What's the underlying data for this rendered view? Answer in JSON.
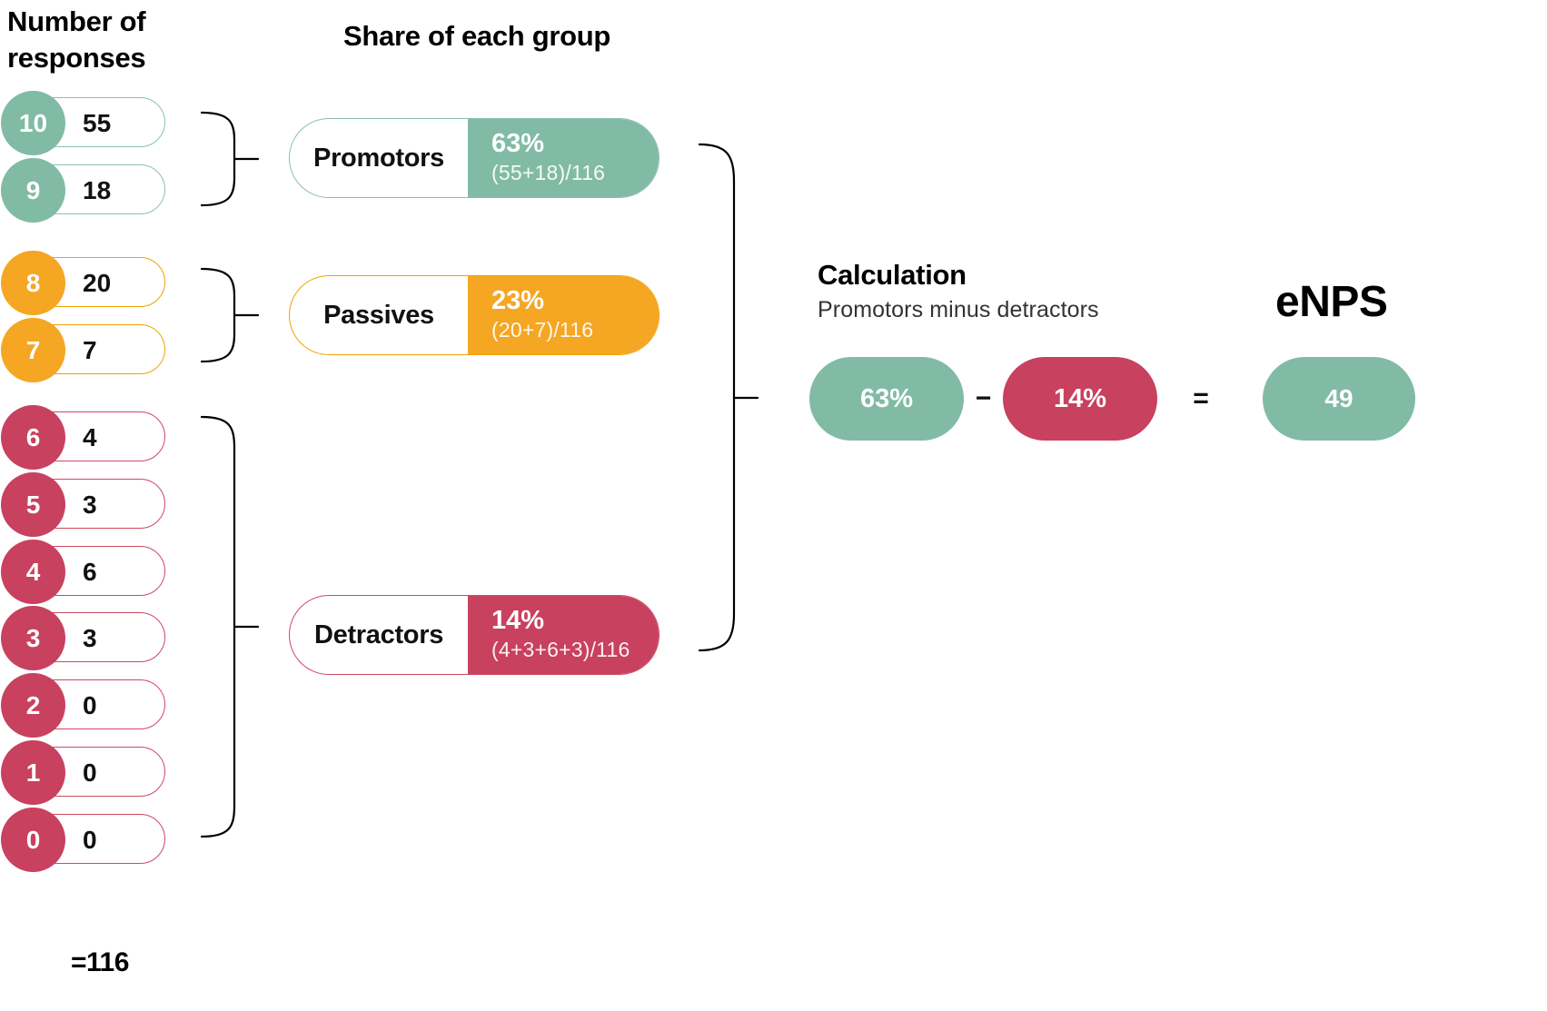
{
  "headings": {
    "responses": "Number of\nresponses",
    "share": "Share of each group"
  },
  "responses": {
    "total_label": "=116",
    "rows": [
      {
        "score": "10",
        "count": "55",
        "group": "promotors"
      },
      {
        "score": "9",
        "count": "18",
        "group": "promotors"
      },
      {
        "score": "8",
        "count": "20",
        "group": "passives"
      },
      {
        "score": "7",
        "count": "7",
        "group": "passives"
      },
      {
        "score": "6",
        "count": "4",
        "group": "detractors"
      },
      {
        "score": "5",
        "count": "3",
        "group": "detractors"
      },
      {
        "score": "4",
        "count": "6",
        "group": "detractors"
      },
      {
        "score": "3",
        "count": "3",
        "group": "detractors"
      },
      {
        "score": "2",
        "count": "0",
        "group": "detractors"
      },
      {
        "score": "1",
        "count": "0",
        "group": "detractors"
      },
      {
        "score": "0",
        "count": "0",
        "group": "detractors"
      }
    ]
  },
  "groups": [
    {
      "label": "Promotors",
      "percent": "63%",
      "formula": "(55+18)/116",
      "color": "#81bba5"
    },
    {
      "label": "Passives",
      "percent": "23%",
      "formula": "(20+7)/116",
      "color": "#f5a623"
    },
    {
      "label": "Detractors",
      "percent": "14%",
      "formula": "(4+3+6+3)/116",
      "color": "#c8415f"
    }
  ],
  "calculation": {
    "heading": "Calculation",
    "subtitle": "Promotors minus detractors",
    "promotors_value": "63%",
    "detractors_value": "14%",
    "minus_symbol": "−",
    "equals_symbol": "=",
    "result": "49"
  },
  "enps": {
    "title": "eNPS"
  },
  "chart_data": {
    "type": "bar",
    "title": "eNPS calculation breakdown",
    "categories": [
      "Promotors",
      "Passives",
      "Detractors"
    ],
    "values": [
      63,
      23,
      14
    ],
    "ylabel": "Share of each group (%)",
    "xlabel": "",
    "ylim": [
      0,
      100
    ],
    "grid": false,
    "legend": "none",
    "annotations": [
      "(55+18)/116",
      "(20+7)/116",
      "(4+3+6+3)/116"
    ],
    "score_distribution": {
      "scores": [
        10,
        9,
        8,
        7,
        6,
        5,
        4,
        3,
        2,
        1,
        0
      ],
      "counts": [
        55,
        18,
        20,
        7,
        4,
        3,
        6,
        3,
        0,
        0,
        0
      ],
      "total": 116
    },
    "result": {
      "formula": "63% - 14%",
      "value": 49
    }
  }
}
